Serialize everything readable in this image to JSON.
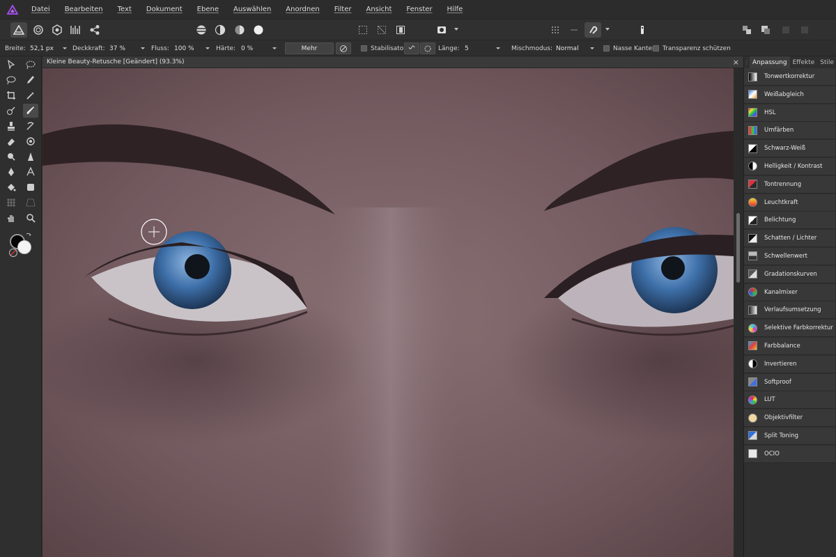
{
  "menubar": {
    "items": [
      "Datei",
      "Bearbeiten",
      "Text",
      "Dokument",
      "Ebene",
      "Auswählen",
      "Anordnen",
      "Filter",
      "Ansicht",
      "Fenster",
      "Hilfe"
    ]
  },
  "context": {
    "breite_label": "Breite:",
    "breite_value": "52,1 px",
    "deckkraft_label": "Deckkraft:",
    "deckkraft_value": "37 %",
    "fluss_label": "Fluss:",
    "fluss_value": "100 %",
    "haerte_label": "Härte:",
    "haerte_value": "0 %",
    "mehr_label": "Mehr",
    "stabilisator_label": "Stabilisator",
    "laenge_label": "Länge:",
    "laenge_value": "5",
    "mischmodus_label": "Mischmodus:",
    "mischmodus_value": "Normal",
    "nasse_kanten_label": "Nasse Kanten",
    "transparenz_label": "Transparenz schützen"
  },
  "document": {
    "tab_title": "Kleine Beauty-Retusche [Geändert] (93.3%)",
    "close_glyph": "×"
  },
  "panel": {
    "tabs": [
      "Anpassung",
      "Effekte",
      "Stile"
    ],
    "items": [
      "Tonwertkorrektur",
      "Weißabgleich",
      "HSL",
      "Umfärben",
      "Schwarz-Weiß",
      "Helligkeit / Kontrast",
      "Tontrennung",
      "Leuchtkraft",
      "Belichtung",
      "Schatten / Lichter",
      "Schwellenwert",
      "Gradationskurven",
      "Kanalmixer",
      "Verlaufsumsetzung",
      "Selektive Farbkorrektur",
      "Farbbalance",
      "Invertieren",
      "Softproof",
      "LUT",
      "Objektivfilter",
      "Split Toning",
      "OCIO"
    ]
  },
  "colors": {
    "accent": "#8a3fe0",
    "foreground": "#050505",
    "background": "#f4f4f4",
    "iris": "#3c6ea8"
  }
}
